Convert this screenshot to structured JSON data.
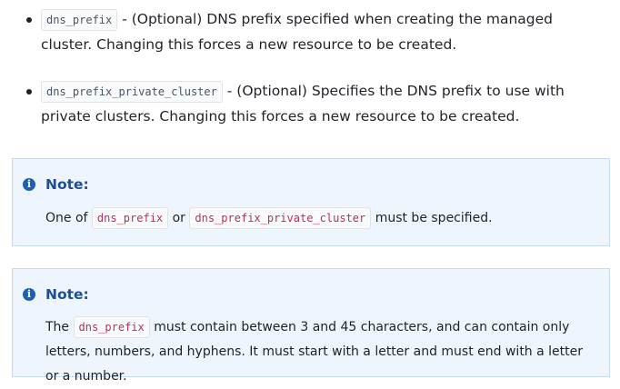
{
  "arguments": [
    {
      "name": "dns_prefix",
      "description": "- (Optional) DNS prefix specified when creating the managed cluster. Changing this forces a new resource to be created."
    },
    {
      "name": "dns_prefix_private_cluster",
      "description": "- (Optional) Specifies the DNS prefix to use with private clusters. Changing this forces a new resource to be created."
    }
  ],
  "notes": [
    {
      "title": "Note:",
      "text_before": "One of",
      "code_1": "dns_prefix",
      "text_middle": "or",
      "code_2": "dns_prefix_private_cluster",
      "text_after": "must be specified."
    },
    {
      "title": "Note:",
      "text_before": "The",
      "code_1": "dns_prefix",
      "text_after": "must contain between 3 and 45 characters, and can contain only letters, numbers, and hyphens. It must start with a letter and must end with a letter or a number."
    }
  ],
  "icons": {
    "info": "info-icon",
    "info_glyph": "i"
  },
  "colors": {
    "note_background": "#eef5fd",
    "note_border": "#c7daf2",
    "note_title": "#1d4f94",
    "code_highlight": "#c02c59"
  }
}
